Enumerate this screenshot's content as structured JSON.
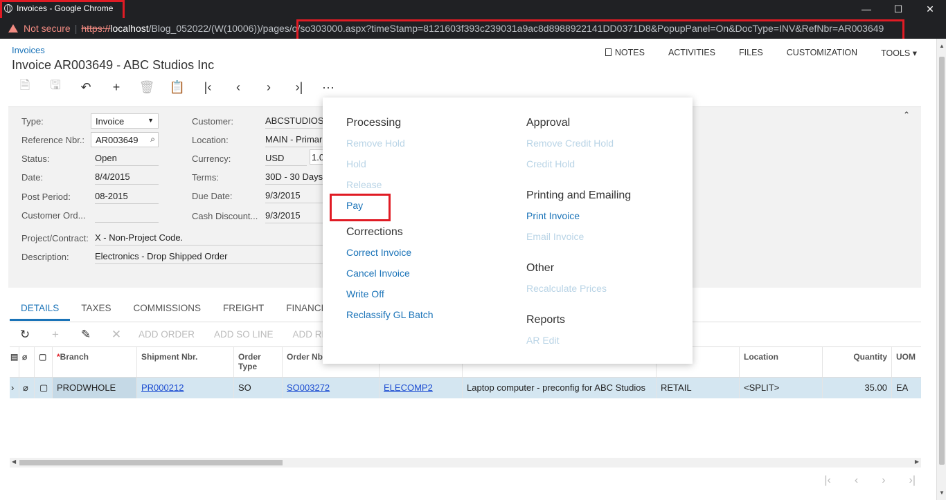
{
  "window": {
    "title": "Invoices - Google Chrome"
  },
  "address": {
    "security": "Not secure",
    "scheme": "https://",
    "host": "localhost",
    "path": "/Blog_052022/(W(10006))/pages/",
    "rest": "o/so303000.aspx?timeStamp=8121603f393c239031a9ac8d8988922141DD0371D8&PopupPanel=On&DocType=INV&RefNbr=AR003649"
  },
  "header": {
    "breadcrumb": "Invoices",
    "title": "Invoice AR003649 - ABC Studios Inc",
    "menu": [
      "NOTES",
      "ACTIVITIES",
      "FILES",
      "CUSTOMIZATION",
      "TOOLS ▾"
    ]
  },
  "toolbar": {
    "more_label": "···"
  },
  "form": {
    "type_label": "Type:",
    "type_value": "Invoice",
    "ref_label": "Reference Nbr.:",
    "ref_value": "AR003649",
    "status_label": "Status:",
    "status_value": "Open",
    "date_label": "Date:",
    "date_value": "8/4/2015",
    "period_label": "Post Period:",
    "period_value": "08-2015",
    "custord_label": "Customer Ord...",
    "custord_value": "",
    "project_label": "Project/Contract:",
    "project_value": "X - Non-Project Code.",
    "desc_label": "Description:",
    "desc_value": "Electronics - Drop Shipped Order",
    "customer_label": "Customer:",
    "customer_value": "ABCSTUDIOS",
    "location_label": "Location:",
    "location_value": "MAIN - Primar",
    "currency_label": "Currency:",
    "currency_value": "USD",
    "currency_rate": "1.0",
    "terms_label": "Terms:",
    "terms_value": "30D - 30 Days",
    "due_label": "Due Date:",
    "due_value": "9/3/2015",
    "cashdisc_label": "Cash Discount...",
    "cashdisc_value": "9/3/2015"
  },
  "tabs": [
    "DETAILS",
    "TAXES",
    "COMMISSIONS",
    "FREIGHT",
    "FINANCIA"
  ],
  "gridbar": [
    "ADD ORDER",
    "ADD SO LINE",
    "ADD RE"
  ],
  "grid": {
    "headers": [
      "Branch",
      "Shipment Nbr.",
      "Order Type",
      "Order Nbr",
      "",
      "",
      "ase",
      "Location",
      "Quantity",
      "UOM"
    ],
    "branch_required": "*",
    "row": {
      "branch": "PRODWHOLE",
      "shipment": "PR000212",
      "order_type": "SO",
      "order_nbr": "SO003272",
      "item": "ELECOMP2",
      "description": "Laptop computer - preconfig for ABC Studios",
      "warehouse": "RETAIL",
      "location": "<SPLIT>",
      "quantity": "35.00",
      "uom": "EA"
    }
  },
  "popup": {
    "processing": {
      "title": "Processing",
      "items": [
        "Remove Hold",
        "Hold",
        "Release",
        "Pay"
      ]
    },
    "corrections": {
      "title": "Corrections",
      "items": [
        "Correct Invoice",
        "Cancel Invoice",
        "Write Off",
        "Reclassify GL Batch"
      ]
    },
    "approval": {
      "title": "Approval",
      "items": [
        "Remove Credit Hold",
        "Credit Hold"
      ]
    },
    "printing": {
      "title": "Printing and Emailing",
      "items": [
        "Print Invoice",
        "Email Invoice"
      ]
    },
    "other": {
      "title": "Other",
      "items": [
        "Recalculate Prices"
      ]
    },
    "reports": {
      "title": "Reports",
      "items": [
        "AR Edit"
      ]
    }
  }
}
